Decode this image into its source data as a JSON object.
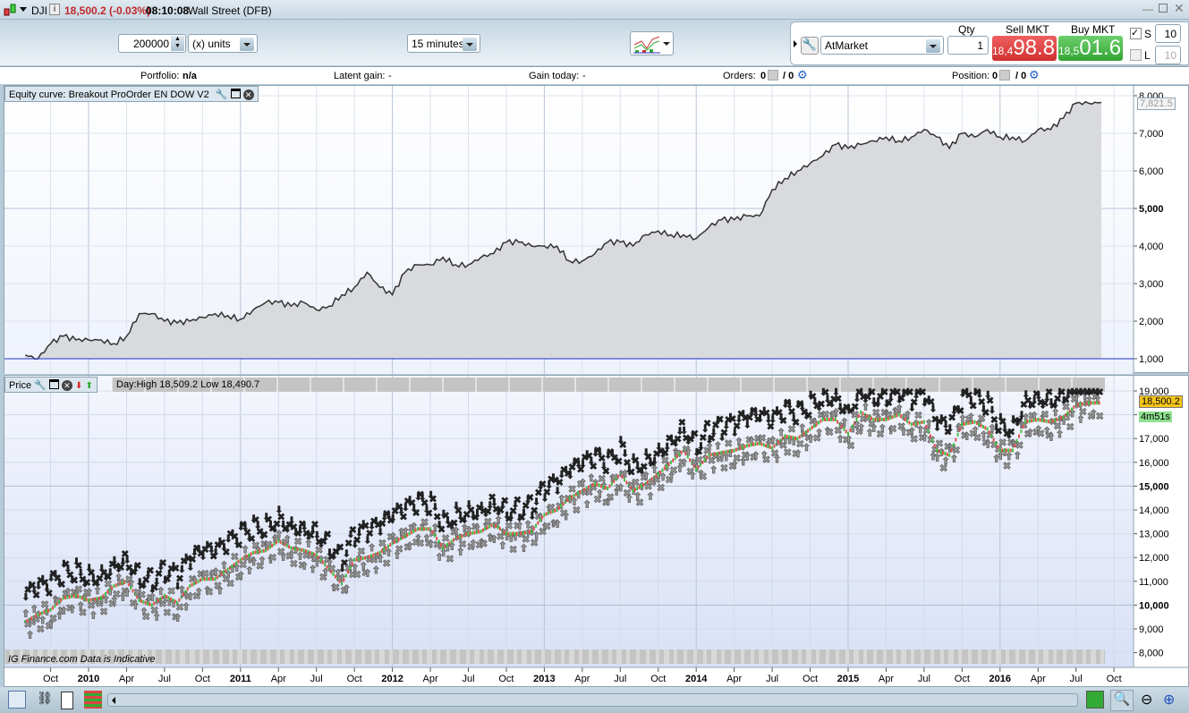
{
  "titlebar": {
    "symbol": "DJI",
    "price": "18,500.2 (-0.03%)",
    "time": "08:10:08",
    "market": "Wall Street (DFB)",
    "price_color": "#c0282d"
  },
  "toolbar": {
    "amount": "200000",
    "units": "(x) units",
    "timeframe": "15 minutes",
    "order_type": "AtMarket",
    "qty_label": "Qty",
    "qty": "1",
    "sell_label": "Sell MKT",
    "sell_prefix": "18,4",
    "sell_main": "98.8",
    "buy_label": "Buy MKT",
    "buy_prefix": "18,5",
    "buy_main": "01.6",
    "s_label": "S",
    "s_value": "10",
    "l_label": "L",
    "l_value": "10"
  },
  "info": {
    "portfolio_label": "Portfolio:",
    "portfolio_value": "n/a",
    "latent_label": "Latent gain:",
    "latent_value": "-",
    "gain_label": "Gain today:",
    "gain_value": "-",
    "orders_label": "Orders:",
    "orders_a": "0",
    "orders_b": "/ 0",
    "position_label": "Position:",
    "position_a": "0",
    "position_b": "/ 0"
  },
  "equity_panel": {
    "title": "Equity curve: Breakout ProOrder EN DOW V2",
    "last_value": "7,821.5"
  },
  "price_panel": {
    "title": "Price",
    "day_info": "Day:High 18,509.2 Low 18,490.7",
    "last_price": "18,500.2",
    "countdown": "4m51s",
    "footer": "IG Finance.com  Data is Indicative"
  },
  "colors": {
    "sell": "#d83b3b",
    "buy": "#3eaa3e",
    "last_price_bg": "#f5c518",
    "countdown_bg": "#8fe08f"
  },
  "chart_data": [
    {
      "type": "area",
      "title": "Equity curve: Breakout ProOrder EN DOW V2",
      "ylim": [
        1000,
        8000
      ],
      "yticks": [
        "1,000",
        "2,000",
        "3,000",
        "4,000",
        "5,000",
        "6,000",
        "7,000",
        "8,000"
      ],
      "baseline": 1000,
      "x_months_from_jan2010": [
        -5,
        -4,
        -3,
        -2,
        -1,
        0,
        1,
        2,
        3,
        4,
        5,
        6,
        7,
        8,
        9,
        10,
        11,
        12,
        13,
        14,
        15,
        16,
        17,
        18,
        19,
        20,
        21,
        22,
        23,
        24,
        25,
        26,
        27,
        28,
        29,
        30,
        31,
        32,
        33,
        34,
        35,
        36,
        37,
        38,
        39,
        40,
        41,
        42,
        43,
        44,
        45,
        46,
        47,
        48,
        49,
        50,
        51,
        52,
        53,
        54,
        55,
        56,
        57,
        58,
        59,
        60,
        61,
        62,
        63,
        64,
        65,
        66,
        67,
        68,
        69,
        70,
        71,
        72,
        73,
        74,
        75,
        76,
        77,
        78,
        79,
        80
      ],
      "values": [
        1100,
        1000,
        1400,
        1600,
        1500,
        1500,
        1500,
        1400,
        1600,
        2200,
        2200,
        2000,
        1950,
        2000,
        2100,
        2200,
        2150,
        2050,
        2300,
        2500,
        2500,
        2400,
        2500,
        2300,
        2400,
        2700,
        2900,
        3300,
        2900,
        2700,
        3300,
        3500,
        3500,
        3700,
        3500,
        3500,
        3700,
        3800,
        4100,
        4100,
        4000,
        4000,
        4000,
        3600,
        3600,
        3800,
        4100,
        4100,
        4000,
        4300,
        4400,
        4300,
        4300,
        4200,
        4500,
        4700,
        4700,
        4800,
        4800,
        5500,
        5800,
        6000,
        6200,
        6400,
        6700,
        6600,
        6700,
        6800,
        6900,
        6800,
        6900,
        7100,
        6900,
        6600,
        7000,
        6900,
        7100,
        6900,
        6900,
        6800,
        7100,
        7100,
        7400,
        7800,
        7800,
        7821.5
      ]
    },
    {
      "type": "scatter",
      "title": "Price",
      "ylim": [
        8000,
        19000
      ],
      "yticks": [
        "8,000",
        "9,000",
        "10,000",
        "11,000",
        "12,000",
        "13,000",
        "14,000",
        "15,000",
        "16,000",
        "17,000",
        "18,000",
        "19,000"
      ],
      "xticks": [
        "Oct",
        "2010",
        "Apr",
        "Jul",
        "Oct",
        "2011",
        "Apr",
        "Jul",
        "Oct",
        "2012",
        "Apr",
        "Jul",
        "Oct",
        "2013",
        "Apr",
        "Jul",
        "Oct",
        "2014",
        "Apr",
        "Jul",
        "Oct",
        "2015",
        "Apr",
        "Jul",
        "Oct",
        "2016",
        "Apr",
        "Jul",
        "Oct"
      ],
      "x_months_from_jan2010": [
        -5,
        -4,
        -3,
        -2,
        -1,
        0,
        1,
        2,
        3,
        4,
        5,
        6,
        7,
        8,
        9,
        10,
        11,
        12,
        13,
        14,
        15,
        16,
        17,
        18,
        19,
        20,
        21,
        22,
        23,
        24,
        25,
        26,
        27,
        28,
        29,
        30,
        31,
        32,
        33,
        34,
        35,
        36,
        37,
        38,
        39,
        40,
        41,
        42,
        43,
        44,
        45,
        46,
        47,
        48,
        49,
        50,
        51,
        52,
        53,
        54,
        55,
        56,
        57,
        58,
        59,
        60,
        61,
        62,
        63,
        64,
        65,
        66,
        67,
        68,
        69,
        70,
        71,
        72,
        73,
        74,
        75,
        76,
        77,
        78,
        79,
        80
      ],
      "values": [
        9300,
        9600,
        9800,
        10300,
        10400,
        10200,
        10300,
        10800,
        11000,
        10200,
        10000,
        10400,
        10100,
        10800,
        11100,
        11100,
        11500,
        11900,
        12200,
        12300,
        12700,
        12400,
        12300,
        12100,
        11500,
        10900,
        11900,
        12000,
        12200,
        12600,
        12900,
        13200,
        13200,
        12400,
        12800,
        13000,
        13100,
        13400,
        13000,
        13000,
        13100,
        13800,
        14000,
        14500,
        14800,
        15100,
        14900,
        15500,
        14800,
        15100,
        15500,
        16000,
        16500,
        15700,
        16300,
        16400,
        16500,
        16700,
        16800,
        16600,
        17100,
        17000,
        17400,
        17800,
        17800,
        17200,
        18100,
        17800,
        17800,
        18000,
        17600,
        17700,
        16500,
        16300,
        17600,
        17700,
        17400,
        16500,
        16500,
        17700,
        17800,
        17700,
        17900,
        18400,
        18500,
        18500
      ]
    }
  ]
}
